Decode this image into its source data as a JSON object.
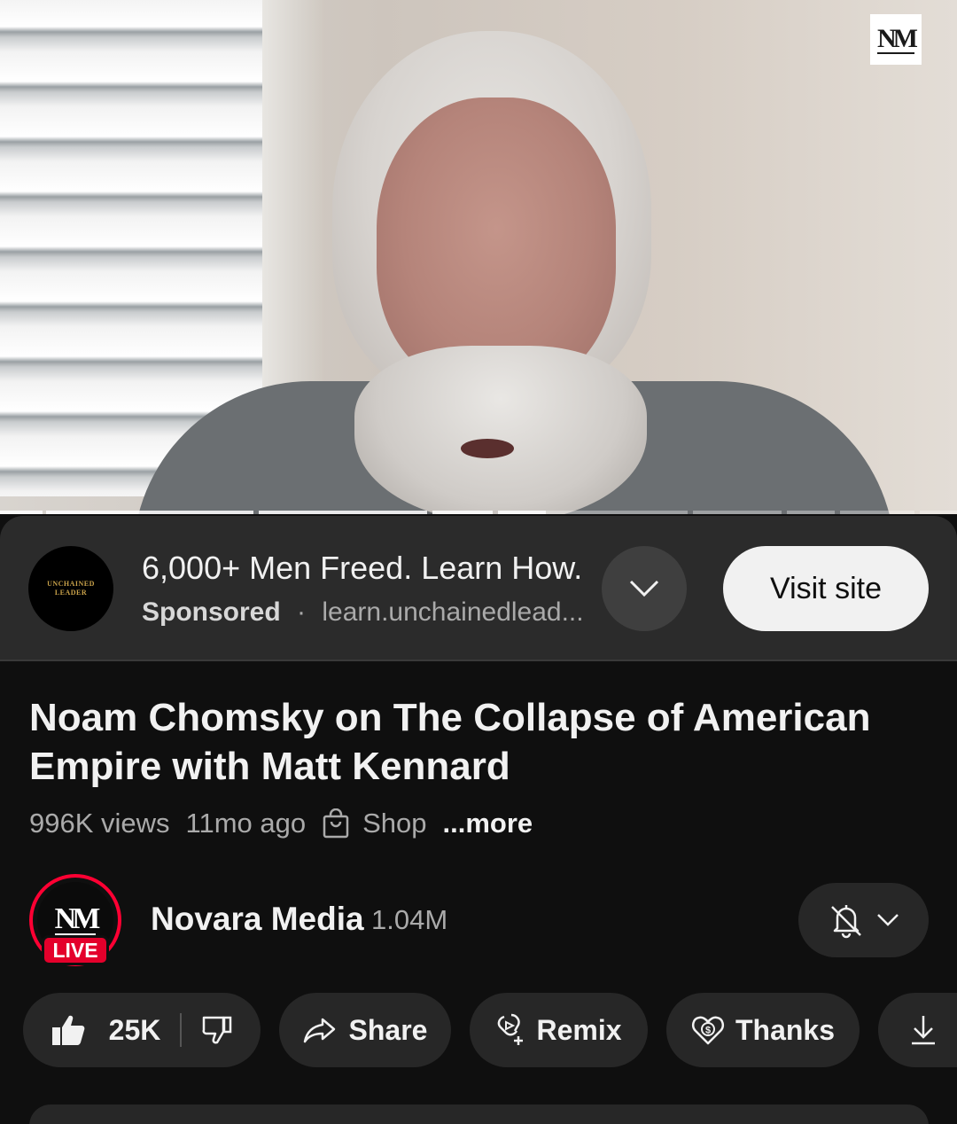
{
  "video": {
    "watermark": "N"
  },
  "ad": {
    "logo_line1": "UNCHAINED",
    "logo_line2": "LEADER",
    "headline": "6,000+ Men Freed. Learn How.",
    "sponsored_label": "Sponsored",
    "separator": "·",
    "url": "learn.unchainedlead...",
    "visit_label": "Visit site"
  },
  "video_info": {
    "title": "Noam Chomsky on The Collapse of American Empire with Matt Kennard",
    "views": "996K views",
    "age": "11mo ago",
    "shop_label": "Shop",
    "more_label": "...more"
  },
  "channel": {
    "avatar_text": "N",
    "live_badge": "LIVE",
    "name": "Novara Media",
    "subscribers": "1.04M"
  },
  "actions": {
    "like_count": "25K",
    "share_label": "Share",
    "remix_label": "Remix",
    "thanks_label": "Thanks"
  },
  "colors": {
    "background": "#0f0f0f",
    "chip": "#272727",
    "live_red": "#e4002b",
    "text_secondary": "#aaaaaa"
  },
  "icons": [
    "chevron-down-icon",
    "shopping-bag-icon",
    "bell-off-icon",
    "thumbs-up-icon",
    "thumbs-down-icon",
    "share-arrow-icon",
    "remix-icon",
    "thanks-heart-icon",
    "download-icon"
  ]
}
